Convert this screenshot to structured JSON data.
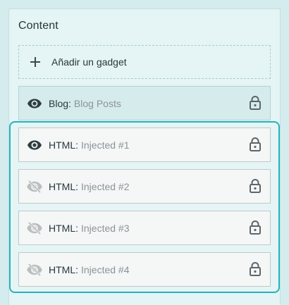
{
  "content": {
    "title": "Content",
    "add_gadget_label": "Añadir un gadget"
  },
  "gadgets": [
    {
      "type": "Blog:",
      "title": "Blog Posts",
      "visible": true,
      "locked": true
    },
    {
      "type": "HTML:",
      "title": "Injected #1",
      "visible": true,
      "locked": true
    },
    {
      "type": "HTML:",
      "title": "Injected #2",
      "visible": false,
      "locked": true
    },
    {
      "type": "HTML:",
      "title": "Injected #3",
      "visible": false,
      "locked": true
    },
    {
      "type": "HTML:",
      "title": "Injected #4",
      "visible": false,
      "locked": true
    }
  ],
  "colors": {
    "highlight": "#26b3bd",
    "icon_visible": "#2f3d40",
    "icon_hidden": "#b9bfc0"
  }
}
